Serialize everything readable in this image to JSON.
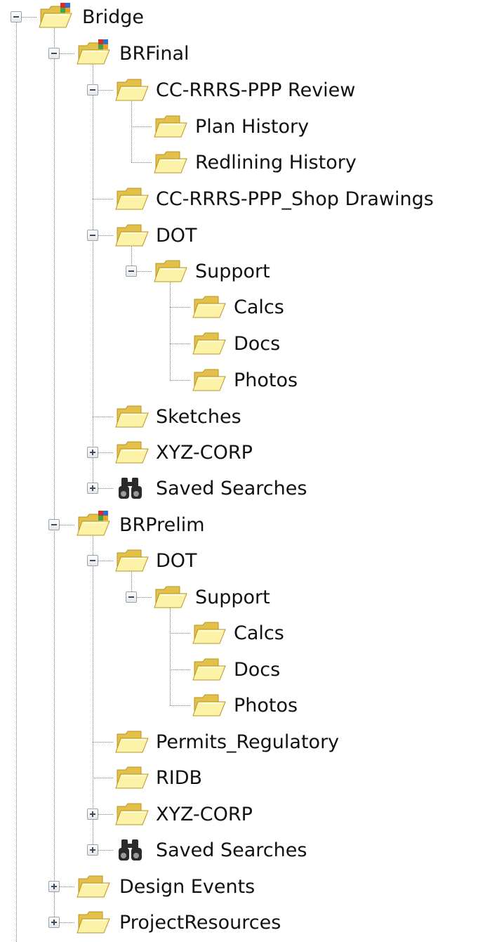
{
  "tree": {
    "nodes": [
      {
        "label": "Bridge",
        "icon": "project-folder-icon",
        "expander": "minus"
      },
      {
        "label": "BRFinal",
        "icon": "project-folder-icon",
        "expander": "minus"
      },
      {
        "label": "CC-RRRS-PPP Review",
        "icon": "folder-icon",
        "expander": "minus"
      },
      {
        "label": "Plan History",
        "icon": "folder-icon",
        "expander": "none"
      },
      {
        "label": "Redlining History",
        "icon": "folder-icon",
        "expander": "none"
      },
      {
        "label": "CC-RRRS-PPP_Shop Drawings",
        "icon": "folder-icon",
        "expander": "none"
      },
      {
        "label": "DOT",
        "icon": "folder-icon",
        "expander": "minus"
      },
      {
        "label": "Support",
        "icon": "folder-icon",
        "expander": "minus"
      },
      {
        "label": "Calcs",
        "icon": "folder-icon",
        "expander": "none"
      },
      {
        "label": "Docs",
        "icon": "folder-icon",
        "expander": "none"
      },
      {
        "label": "Photos",
        "icon": "folder-icon",
        "expander": "none"
      },
      {
        "label": "Sketches",
        "icon": "folder-icon",
        "expander": "none"
      },
      {
        "label": "XYZ-CORP",
        "icon": "folder-icon",
        "expander": "plus"
      },
      {
        "label": "Saved Searches",
        "icon": "binoculars-icon",
        "expander": "plus"
      },
      {
        "label": "BRPrelim",
        "icon": "project-folder-icon",
        "expander": "minus"
      },
      {
        "label": "DOT",
        "icon": "folder-icon",
        "expander": "minus"
      },
      {
        "label": "Support",
        "icon": "folder-icon",
        "expander": "minus"
      },
      {
        "label": "Calcs",
        "icon": "folder-icon",
        "expander": "none"
      },
      {
        "label": "Docs",
        "icon": "folder-icon",
        "expander": "none"
      },
      {
        "label": "Photos",
        "icon": "folder-icon",
        "expander": "none"
      },
      {
        "label": "Permits_Regulatory",
        "icon": "folder-icon",
        "expander": "none"
      },
      {
        "label": "RIDB",
        "icon": "folder-icon",
        "expander": "none"
      },
      {
        "label": "XYZ-CORP",
        "icon": "folder-icon",
        "expander": "plus"
      },
      {
        "label": "Saved Searches",
        "icon": "binoculars-icon",
        "expander": "plus"
      },
      {
        "label": "Design Events",
        "icon": "folder-icon",
        "expander": "plus"
      },
      {
        "label": "ProjectResources",
        "icon": "folder-icon",
        "expander": "plus"
      }
    ]
  },
  "colors": {
    "folder_light": "#fdf3a8",
    "folder_dark": "#e2c04a",
    "folder_edge": "#b99420",
    "tree_line": "#808080",
    "text": "#111111"
  }
}
